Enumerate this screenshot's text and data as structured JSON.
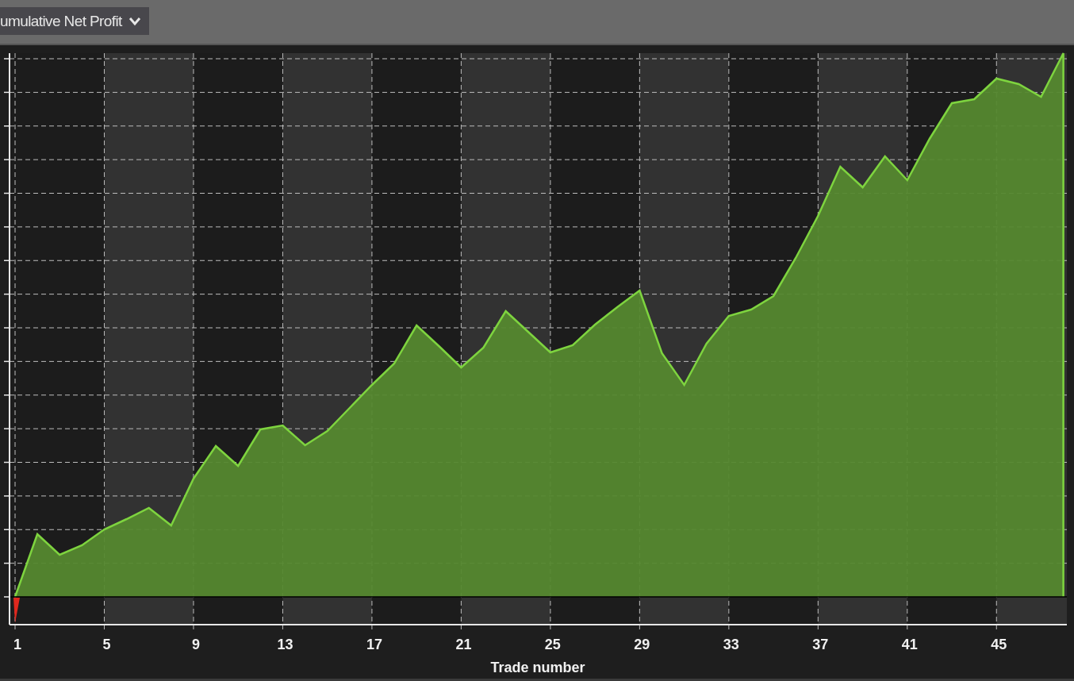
{
  "toolbar": {
    "metric_dropdown": {
      "label": "umulative Net Profit"
    }
  },
  "chart": {
    "x_ticks": [
      "1",
      "5",
      "9",
      "13",
      "17",
      "21",
      "25",
      "29",
      "33",
      "37",
      "41",
      "45"
    ],
    "x_label": "Trade number"
  }
}
